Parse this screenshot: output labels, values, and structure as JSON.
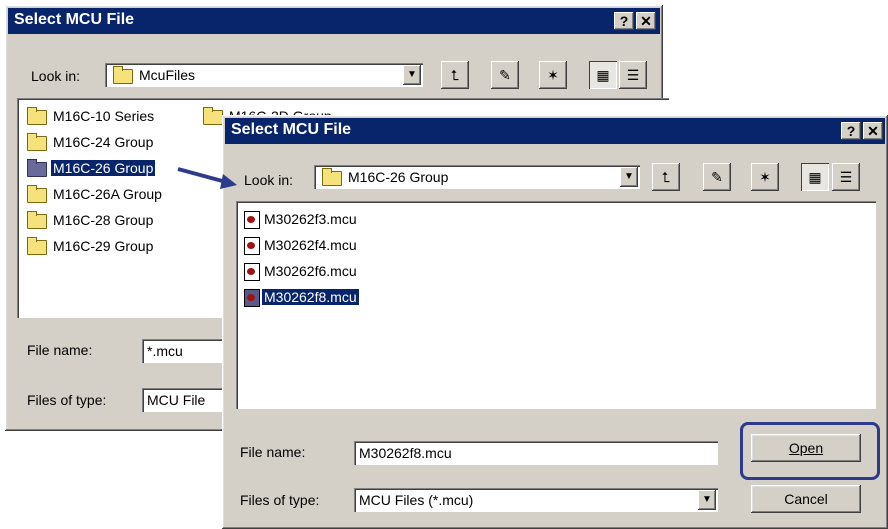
{
  "back_dialog": {
    "title": "Select MCU File",
    "help_glyph": "?",
    "close_glyph": "✕",
    "look_in_label": "Look in:",
    "look_in_value": "McuFiles",
    "folders_col1": [
      "M16C-10 Series",
      "M16C-24 Group",
      "M16C-26 Group",
      "M16C-26A Group",
      "M16C-28 Group",
      "M16C-29 Group"
    ],
    "folders_col2_partial": "M16C-2D Group",
    "selected_folder": "M16C-26 Group",
    "file_name_label": "File name:",
    "file_name_value": "*.mcu",
    "files_of_type_label": "Files of type:",
    "files_of_type_value": "MCU File"
  },
  "front_dialog": {
    "title": "Select MCU File",
    "help_glyph": "?",
    "close_glyph": "✕",
    "look_in_label": "Look in:",
    "look_in_value": "M16C-26 Group",
    "files": [
      "M30262f3.mcu",
      "M30262f4.mcu",
      "M30262f6.mcu",
      "M30262f8.mcu"
    ],
    "selected_file": "M30262f8.mcu",
    "file_name_label": "File name:",
    "file_name_value": "M30262f8.mcu",
    "files_of_type_label": "Files of type:",
    "files_of_type_value": "MCU Files (*.mcu)",
    "open_button": "Open",
    "cancel_button": "Cancel"
  },
  "icons": [
    "up-folder-icon",
    "desktop-icon",
    "new-folder-icon",
    "list-view-icon",
    "details-view-icon",
    "dropdown-arrow-icon",
    "folder-icon",
    "mcu-file-icon"
  ],
  "colors": {
    "titlebar": "#08246b",
    "dialog_face": "#d4d0c8",
    "highlight_frame": "#2e3a8c",
    "arrow": "#2e3a8c"
  }
}
